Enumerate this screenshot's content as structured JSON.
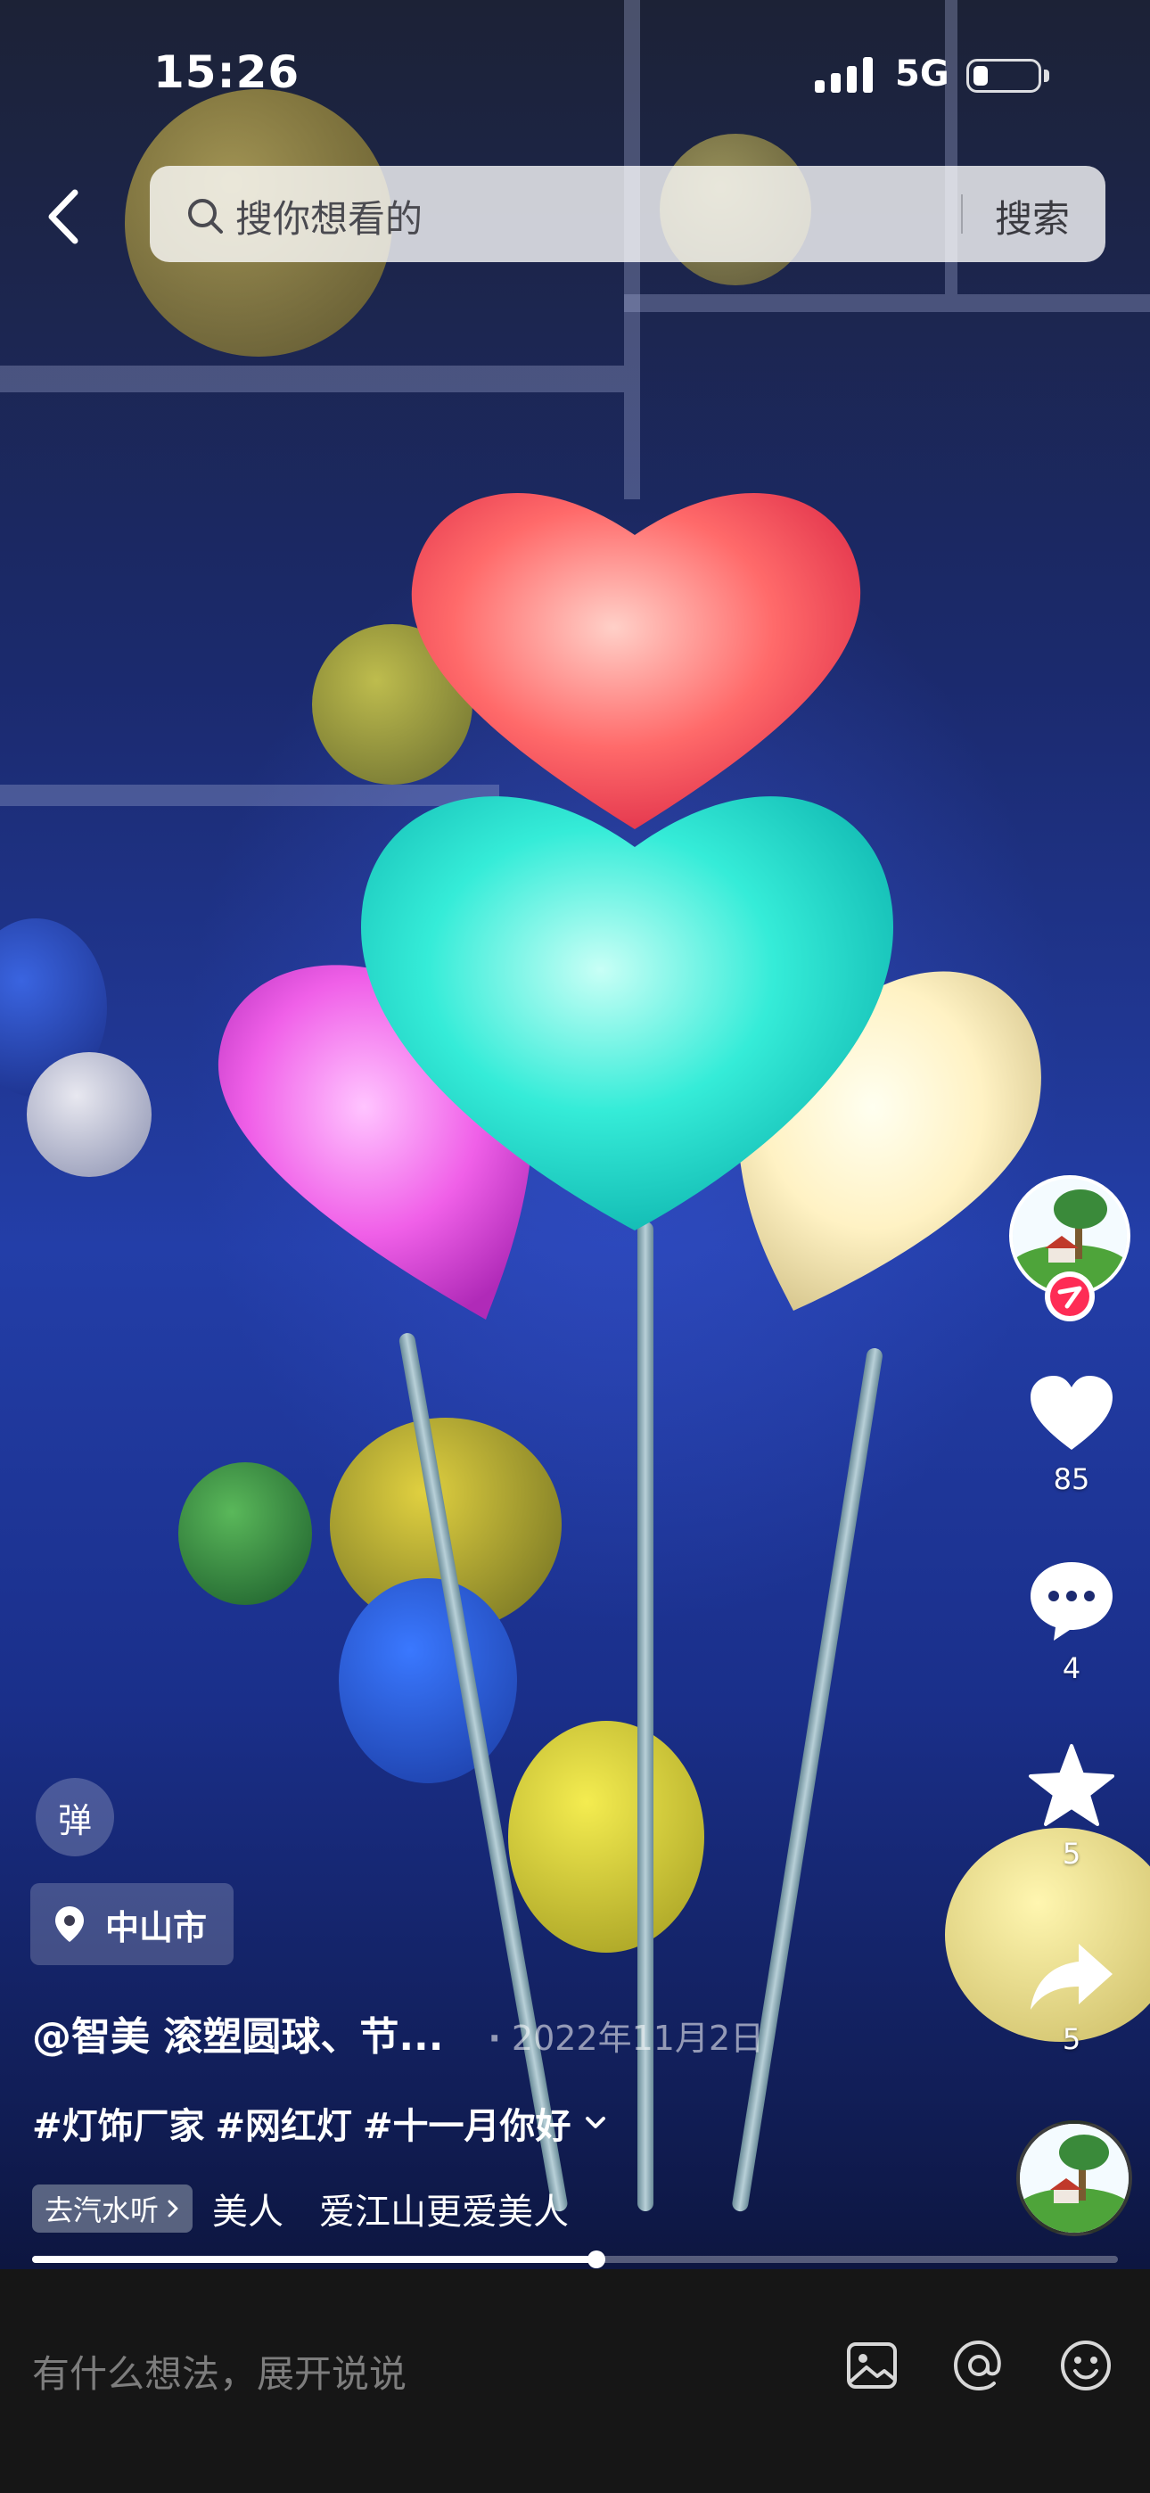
{
  "status_bar": {
    "time": "15:26",
    "network": "5G"
  },
  "header": {
    "search_placeholder": "搜你想看的",
    "search_button": "搜索"
  },
  "actions": {
    "likes": "85",
    "comments": "4",
    "favorites": "5",
    "shares": "5"
  },
  "video_info": {
    "danmu_label": "弹",
    "location": "中山市",
    "author": "@智美 滚塑圆球、节...",
    "date": "2022年11月2日",
    "date_separator": "·",
    "hashtags": [
      "#灯饰厂家",
      "#网红灯",
      "#十一月你好"
    ],
    "music_chip": "去汽水听",
    "music_text": "美人　爱江山更爱美人"
  },
  "progress": {
    "played_fraction": 0.52
  },
  "comment_bar": {
    "placeholder": "有什么想法，展开说说"
  },
  "icons": {
    "back": "chevron-left-icon",
    "search": "search-icon",
    "like": "heart-icon",
    "comment": "comment-bubble-icon",
    "favorite": "star-icon",
    "share": "share-arrow-icon",
    "location": "location-pin-icon",
    "image": "image-icon",
    "mention": "at-sign-icon",
    "emoji": "emoji-icon"
  }
}
